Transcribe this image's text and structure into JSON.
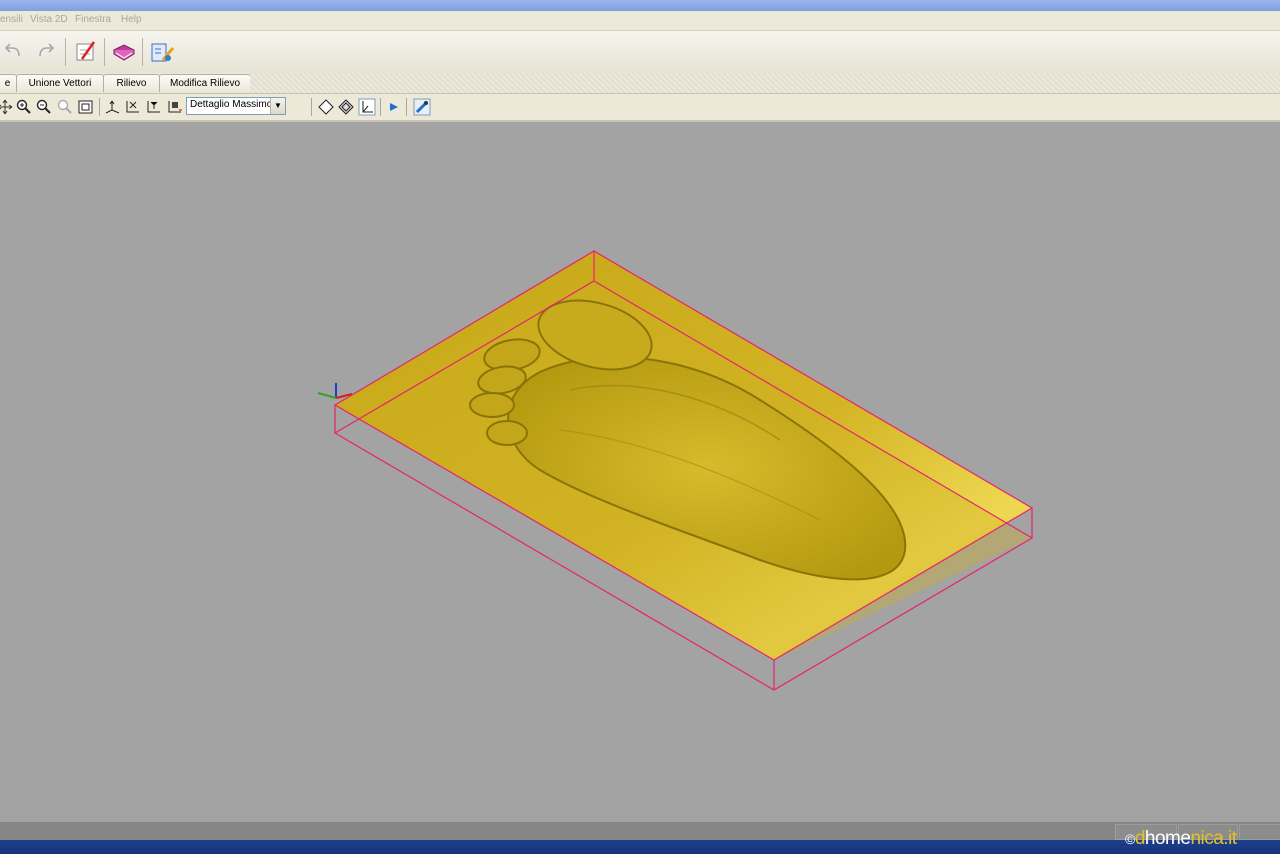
{
  "menu": {
    "items": [
      "ensili",
      "Vista 2D",
      "Finestra",
      "Help"
    ]
  },
  "tabs": [
    "e",
    "Unione Vettori",
    "Rilievo",
    "Modifica Rilievo"
  ],
  "view_toolbar": {
    "detail_level": "Dettaglio Massimo"
  },
  "watermark": {
    "symbol": "©",
    "part1": "d",
    "part2": "home",
    "part3": "nica.it"
  },
  "colors": {
    "relief": "#d9b82a",
    "bounding_box": "#e8236d",
    "viewport_bg": "#a3a3a3"
  }
}
